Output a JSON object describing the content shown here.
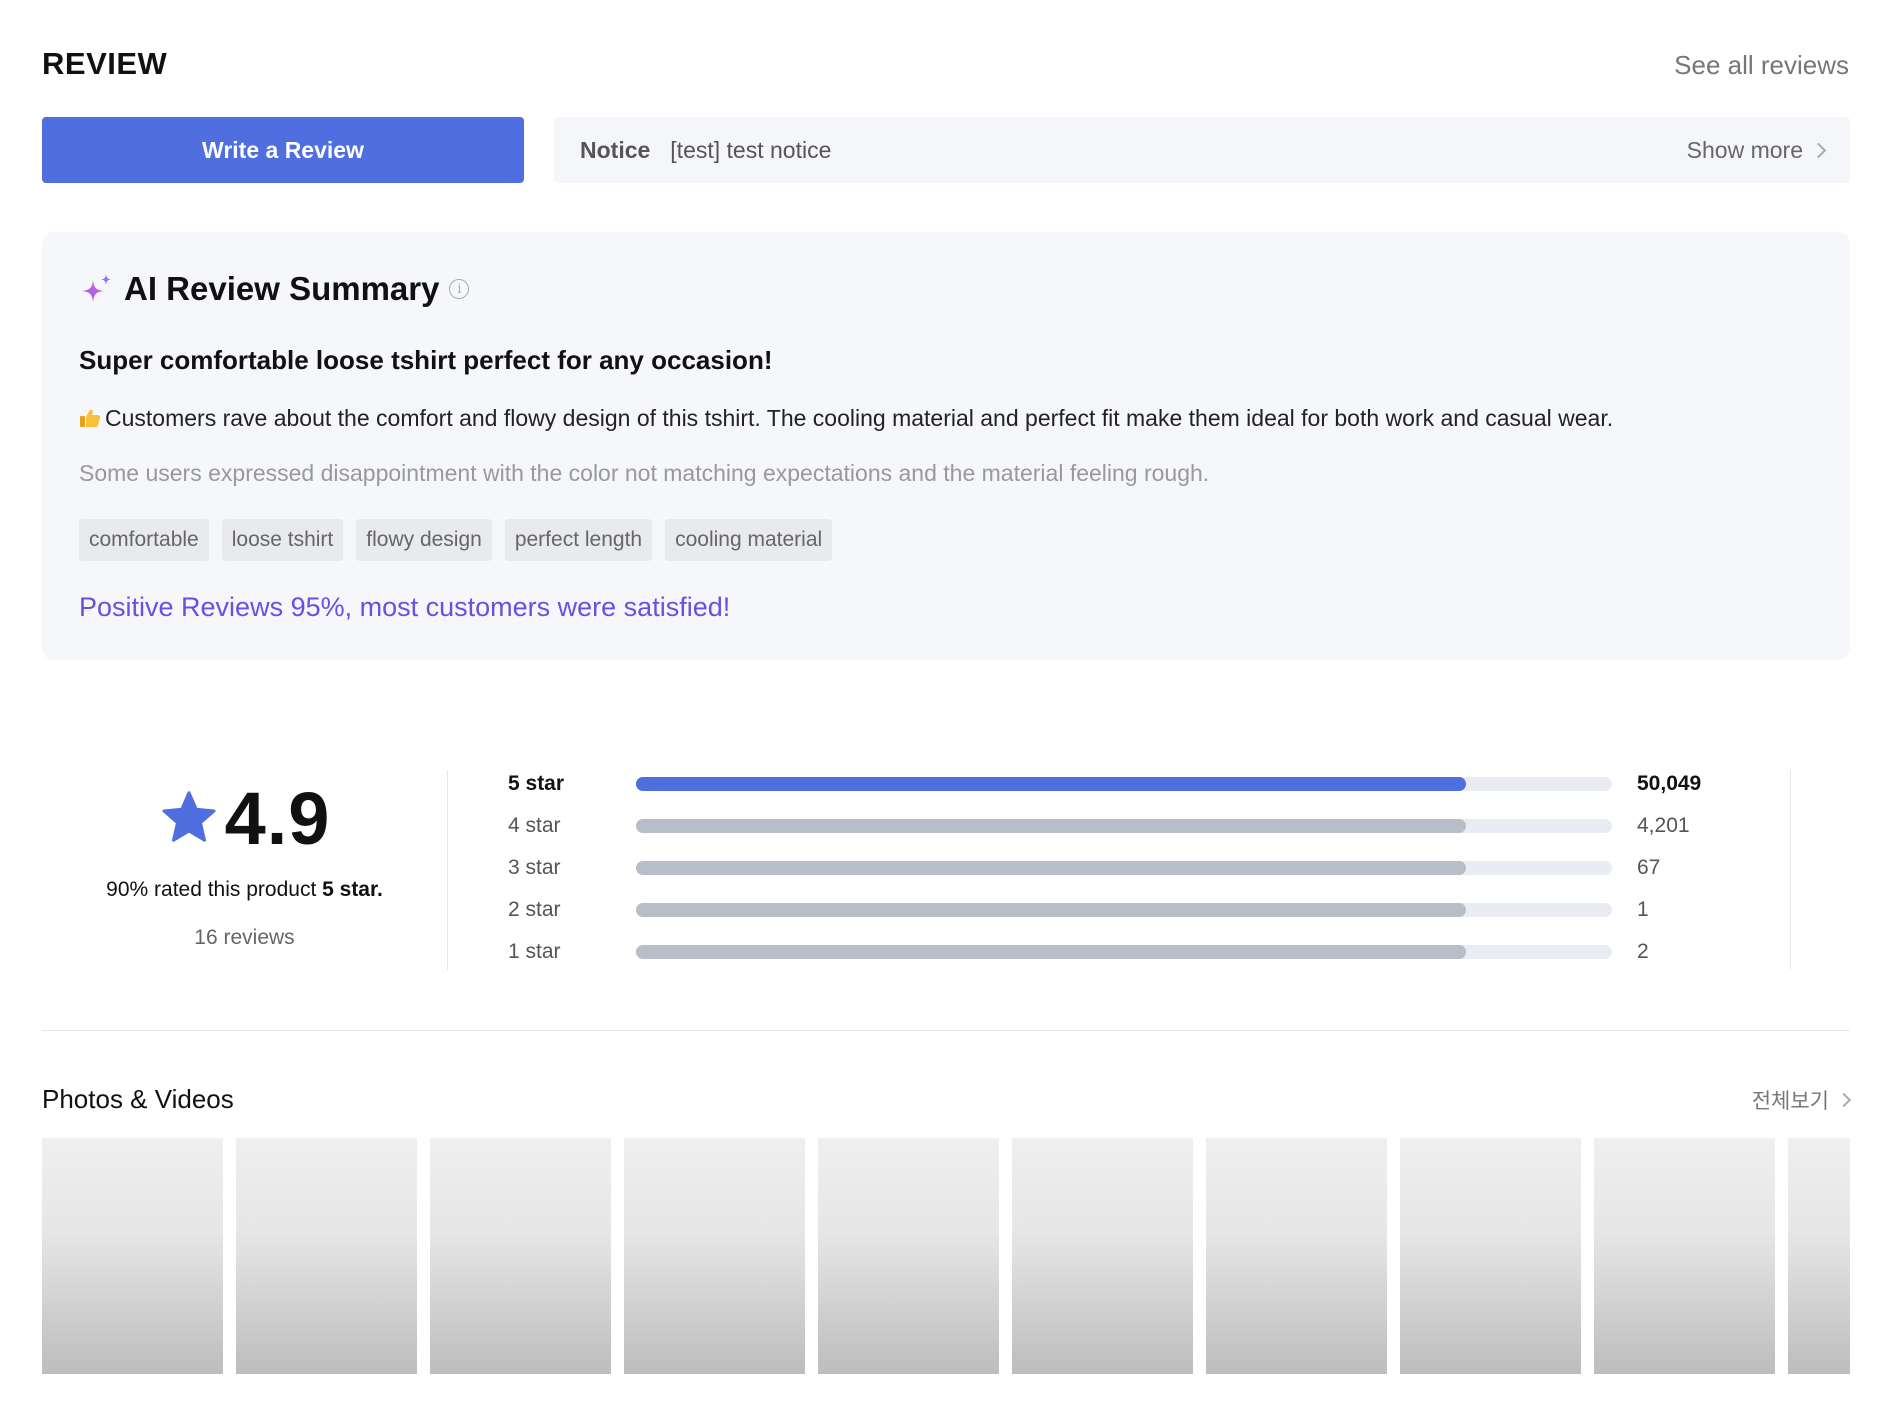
{
  "header": {
    "title": "REVIEW",
    "see_all": "See all reviews",
    "write_review": "Write a Review",
    "notice_label": "Notice",
    "notice_text": "[test] test notice",
    "show_more": "Show more"
  },
  "ai_summary": {
    "title": "AI Review Summary",
    "headline": "Super comfortable loose tshirt perfect for any occasion!",
    "positive": "Customers rave about the comfort and flowy design of this tshirt. The cooling material and perfect fit make them ideal for both work and casual wear.",
    "negative": "Some users expressed disappointment with the color not matching expectations and the material feeling rough.",
    "tags": [
      "comfortable",
      "loose tshirt",
      "flowy design",
      "perfect length",
      "cooling material"
    ],
    "positive_rate": "Positive Reviews 95%, most customers were satisfied!"
  },
  "rating": {
    "score": "4.9",
    "rated_prefix": "90% rated this product ",
    "rated_bold": "5 star.",
    "review_count": "16 reviews",
    "bars": [
      {
        "label": "5 star",
        "count": "50,049",
        "fill": 0.85
      },
      {
        "label": "4 star",
        "count": "4,201",
        "fill": 0.85
      },
      {
        "label": "3 star",
        "count": "67",
        "fill": 0.85
      },
      {
        "label": "2 star",
        "count": "1",
        "fill": 0.85
      },
      {
        "label": "1 star",
        "count": "2",
        "fill": 0.85
      }
    ]
  },
  "photos": {
    "title": "Photos & Videos",
    "view_all": "전체보기",
    "count_visible": 10
  },
  "colors": {
    "accent": "#4f6ee0",
    "purple": "#6a4fe0",
    "bar_gray": "#b8bec8"
  }
}
